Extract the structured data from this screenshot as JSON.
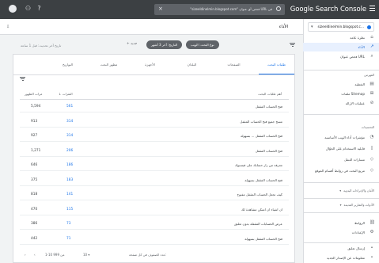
{
  "app": {
    "logo_text": "Google Search Console",
    "search_placeholder": "\"sizeeldinelmin.blogspot.com\" فحص أي عنوان URL في",
    "page_title": "الأداء",
    "avatar_letter": " "
  },
  "filters": {
    "chip_search_type": "نوع البحث: الويب",
    "chip_date": "التاريخ: آخر 3 أشهر",
    "add_new": "+ جديد",
    "last_updated": "تاريخ آخر تحديث: قبل 1 ساعة"
  },
  "tabs": [
    "طلبات البحث",
    "الصفحات",
    "البلدان",
    "الأجهزة",
    "مظهر البحث",
    "التواريخ"
  ],
  "table": {
    "headers": {
      "query": "أهم طلبات البحث",
      "clicks": "النقرات",
      "impressions": "مرات الظهور"
    },
    "rows": [
      {
        "query": "فتح الحساب المقفل",
        "clicks": "561",
        "impressions": "5,594"
      },
      {
        "query": "مسح جميع فتح الحساب المقفل",
        "clicks": "314",
        "impressions": "913"
      },
      {
        "query": "فتح الحساب المقفل ... بسهولة",
        "clicks": "314",
        "impressions": "927"
      },
      {
        "query": "فتح الحساب المقفل",
        "clicks": "206",
        "impressions": "1,271"
      },
      {
        "query": "معرفة من زار حسابك على فيسبوك",
        "clicks": "186",
        "impressions": "646"
      },
      {
        "query": "فتح الحساب المقفل بسهولة",
        "clicks": "183",
        "impressions": "375"
      },
      {
        "query": "كيف تجعل الحساب المقفل مفتوح",
        "clicks": "141",
        "impressions": "818"
      },
      {
        "query": "ان اشياء ان اتمكن مشاهدة لك",
        "clicks": "115",
        "impressions": "470"
      },
      {
        "query": "عرض الحسابات المقفلة بدون تعليق",
        "clicks": "73",
        "impressions": "386"
      },
      {
        "query": "فتح الحساب المقفل بسهولة",
        "clicks": "71",
        "impressions": "442"
      }
    ]
  },
  "pagination": {
    "rows_label": "عدد الصفوف في كل صفحة:",
    "rows_value": "10",
    "range": "1-10 من 999"
  },
  "sidebar": {
    "property": "sizeeldinelmin.blogspot.c...",
    "items": [
      {
        "label": "نظرة عامة",
        "icon": "home-icon"
      },
      {
        "label": "الأداء",
        "icon": "trend-icon",
        "active": true
      },
      {
        "label": "فحص عنوان URL",
        "icon": "search-icon"
      }
    ],
    "section_index": "الفهرس",
    "index_items": [
      {
        "label": "التغطية",
        "icon": "coverage-icon"
      },
      {
        "label": "ملفات Sitemap",
        "icon": "sitemap-icon"
      },
      {
        "label": "عمليات الإزالة",
        "icon": "removals-icon"
      }
    ],
    "section_enhancements": "التحسينات",
    "enh_items": [
      {
        "label": "مؤشرات أداء الويب الأساسية",
        "icon": "gauge-icon"
      },
      {
        "label": "قابلية الاستخدام على الجوّال",
        "icon": "mobile-icon"
      },
      {
        "label": "مسارات التنقل",
        "icon": "breadcrumb-icon"
      },
      {
        "label": "مربع البحث في روابط أقسام الموقع",
        "icon": "sitelinks-icon"
      }
    ],
    "section_security": "الأمان والإجراءات اليدوية",
    "section_legacy": "الأدوات والتقارير القديمة",
    "bottom_items": [
      {
        "label": "الروابط",
        "icon": "links-icon"
      },
      {
        "label": "الإعدادات",
        "icon": "settings-icon"
      }
    ],
    "feedback": "إرسال تعليق",
    "about": "معلومات عن الإصدار الجديد"
  },
  "colors": {
    "topbar": "#3c4043",
    "accent": "#1a73e8",
    "active_bg": "#e8f0fe"
  }
}
